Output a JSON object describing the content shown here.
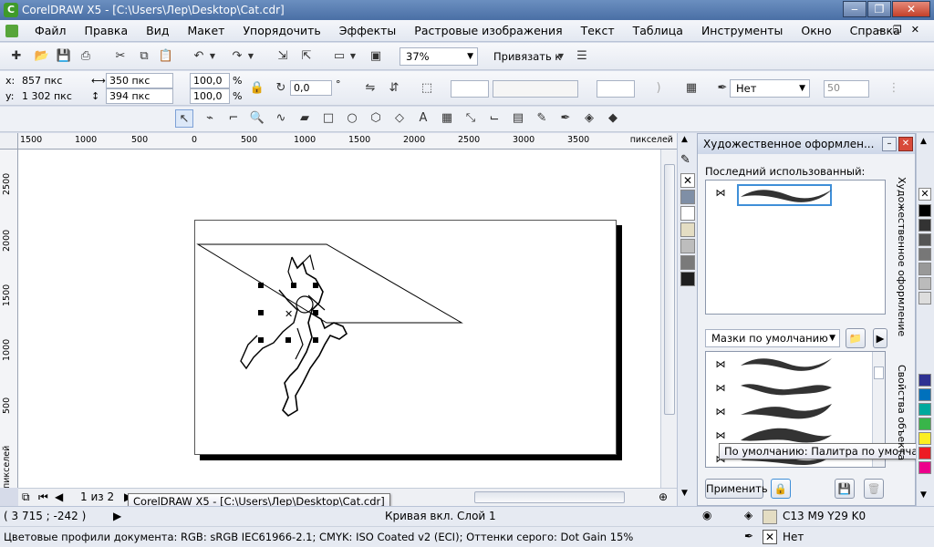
{
  "window": {
    "title": "CorelDRAW X5 - [C:\\Users\\Лер\\Desktop\\Cat.cdr]",
    "app_icon": "coreldraw-icon"
  },
  "menu": {
    "items": [
      "Файл",
      "Правка",
      "Вид",
      "Макет",
      "Упорядочить",
      "Эффекты",
      "Растровые изображения",
      "Текст",
      "Таблица",
      "Инструменты",
      "Окно",
      "Справка"
    ]
  },
  "standard_toolbar": {
    "zoom": "37%",
    "snap_label": "Привязать к"
  },
  "property_bar": {
    "x_label": "x:",
    "x_value": "857 пкс",
    "y_label": "y:",
    "y_value": "1 302 пкс",
    "width_value": "350 пкс",
    "height_value": "394 пкс",
    "scale_w": "100,0",
    "scale_h": "100,0",
    "percent": "%",
    "rotation": "0,0",
    "degree": "°",
    "outline_value": "Нет",
    "nib_value": "50"
  },
  "rulers": {
    "horizontal_ticks": [
      "1500",
      "1000",
      "500",
      "0",
      "500",
      "1000",
      "1500",
      "2000",
      "2500",
      "3000",
      "3500"
    ],
    "unit": "пикселей",
    "vertical_ticks": [
      "2500",
      "2000",
      "1500",
      "1000",
      "500"
    ],
    "vertical_unit": "пикселей"
  },
  "page_nav": {
    "page_info": "1 из 2"
  },
  "taskbar_tooltip": "CorelDRAW X5 - [C:\\Users\\Лер\\Desktop\\Cat.cdr]",
  "docker": {
    "title": "Художественное оформлен...",
    "last_used_label": "Последний использованный:",
    "preset_dropdown": "Мазки по умолчанию",
    "apply_button": "Применить",
    "tooltip": "По умолчанию: Палитра по умолчанию",
    "vertical_tab_1": "Художественное оформление",
    "vertical_tab_2": "Свойства объекта"
  },
  "status": {
    "coords": "( 3 715 ; -242 )",
    "object_info": "Кривая вкл. Слой 1",
    "fill_color_text": "C13 M9 Y29 K0",
    "outline_text": "Нет",
    "color_profiles": "Цветовые профили документа: RGB: sRGB IEC61966-2.1; CMYK: ISO Coated v2 (ECI); Оттенки серого: Dot Gain 15%"
  },
  "colors": {
    "fill_swatch": "#e4ddc3",
    "palette_right": [
      "#ffffff",
      "#000000",
      "#1a1a1a",
      "#333333",
      "#4d4d4d",
      "#666666",
      "#808080",
      "#999999",
      "#b3b3b3",
      "#cccccc",
      "#e6e6e6",
      "#f2f2f2",
      "#2e3192",
      "#0071bc",
      "#00a99d",
      "#39b54a",
      "#8cc63f",
      "#fcee21",
      "#f7931e",
      "#ed1c24",
      "#ec008c",
      "#92278f"
    ],
    "palette_left": [
      "#7f8fa6",
      "#ffffff",
      "#e4ddc3",
      "#bdbdbd",
      "#7a7a7a",
      "#1f1f1f"
    ]
  }
}
